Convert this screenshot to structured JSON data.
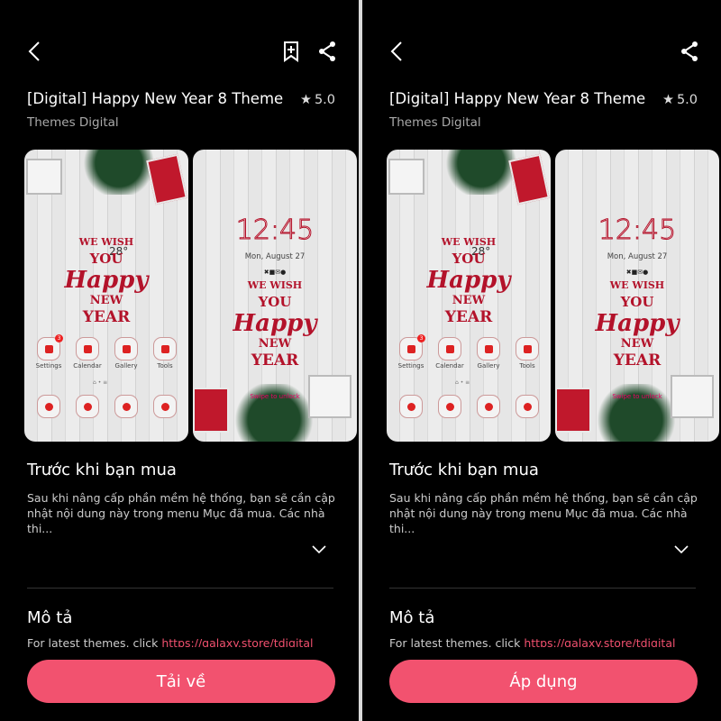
{
  "panels": [
    {
      "show_bookmark": true,
      "title": "[Digital] Happy New Year 8 Theme",
      "rating": "5.0",
      "publisher": "Themes Digital",
      "home_preview": {
        "weather": "28°",
        "greeting": [
          "WE WISH",
          "YOU",
          "Happy",
          "NEW",
          "YEAR"
        ],
        "apps": [
          {
            "label": "Settings",
            "badge": "3"
          },
          {
            "label": "Calendar"
          },
          {
            "label": "Gallery"
          },
          {
            "label": "Tools"
          }
        ]
      },
      "lock_preview": {
        "time": "12:45",
        "date": "Mon, August 27",
        "unlock": "Swipe to unlock",
        "greeting": [
          "WE WISH",
          "YOU",
          "Happy",
          "NEW",
          "YEAR"
        ]
      },
      "before_buy_heading": "Trước khi bạn mua",
      "before_buy_text": "Sau khi nâng cấp phần mềm hệ thống, bạn sẽ cần cập nhật nội dung này trong menu Mục đã mua. Các nhà thi...",
      "description_heading": "Mô tả",
      "description_text": "For latest themes, click ",
      "description_link": "https://galaxy.store/tdigital",
      "action_label": "Tải về"
    },
    {
      "show_bookmark": false,
      "title": "[Digital] Happy New Year 8 Theme",
      "rating": "5.0",
      "publisher": "Themes Digital",
      "home_preview": {
        "weather": "28°",
        "greeting": [
          "WE WISH",
          "YOU",
          "Happy",
          "NEW",
          "YEAR"
        ],
        "apps": [
          {
            "label": "Settings",
            "badge": "3"
          },
          {
            "label": "Calendar"
          },
          {
            "label": "Gallery"
          },
          {
            "label": "Tools"
          }
        ]
      },
      "lock_preview": {
        "time": "12:45",
        "date": "Mon, August 27",
        "unlock": "Swipe to unlock",
        "greeting": [
          "WE WISH",
          "YOU",
          "Happy",
          "NEW",
          "YEAR"
        ]
      },
      "before_buy_heading": "Trước khi bạn mua",
      "before_buy_text": "Sau khi nâng cấp phần mềm hệ thống, bạn sẽ cần cập nhật nội dung này trong menu Mục đã mua. Các nhà thi...",
      "description_heading": "Mô tả",
      "description_text": "For latest themes, click ",
      "description_link": "https://galaxy.store/tdigital",
      "action_label": "Áp dụng"
    }
  ],
  "colors": {
    "accent": "#f2526f",
    "background": "#000000",
    "theme_red": "#b3122a"
  },
  "icons": [
    "back-arrow",
    "bookmark-plus",
    "share",
    "star",
    "chevron-down"
  ]
}
